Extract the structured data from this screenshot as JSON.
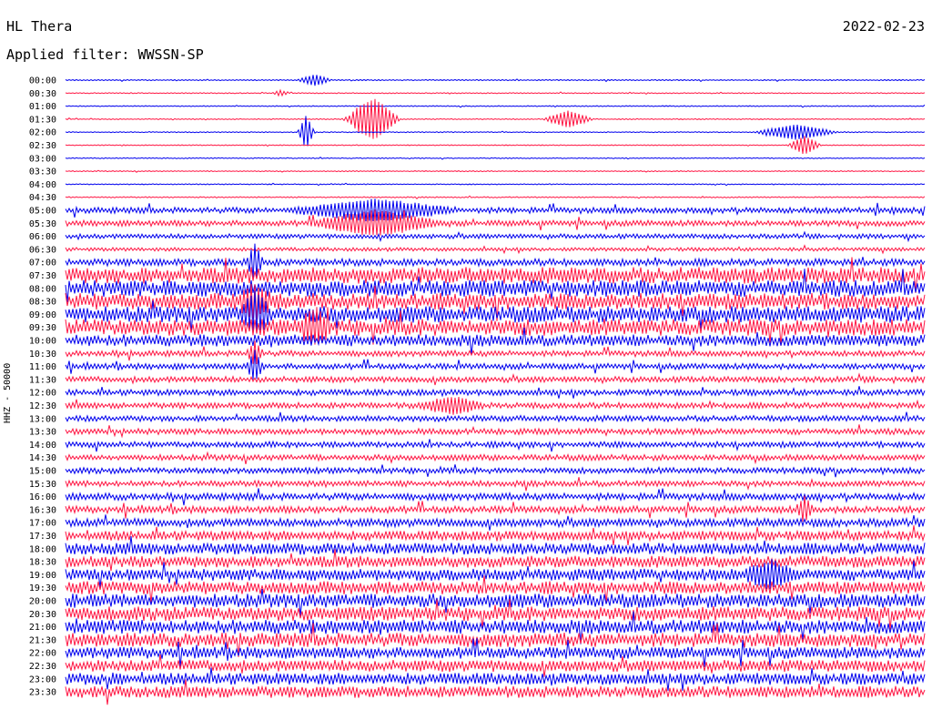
{
  "header": {
    "station": "HL Thera",
    "date": "2022-02-23",
    "filter_label": "Applied filter: WWSSN-SP",
    "channel_label": "HHZ - 50000"
  },
  "colors": {
    "even": "#0000ee",
    "odd": "#ff1744"
  },
  "chart_data": {
    "type": "line",
    "title": "HL Thera",
    "rows": [
      "00:00",
      "00:30",
      "01:00",
      "01:30",
      "02:00",
      "02:30",
      "03:00",
      "03:30",
      "04:00",
      "04:30",
      "05:00",
      "05:30",
      "06:00",
      "06:30",
      "07:00",
      "07:30",
      "08:00",
      "08:30",
      "09:00",
      "09:30",
      "10:00",
      "10:30",
      "11:00",
      "11:30",
      "12:00",
      "12:30",
      "13:00",
      "13:30",
      "14:00",
      "14:30",
      "15:00",
      "15:30",
      "16:00",
      "16:30",
      "17:00",
      "17:30",
      "18:00",
      "18:30",
      "19:00",
      "19:30",
      "20:00",
      "20:30",
      "21:00",
      "21:30",
      "22:00",
      "22:30",
      "23:00",
      "23:30"
    ],
    "noise_level": [
      0.5,
      0.4,
      0.4,
      0.4,
      0.4,
      0.4,
      0.4,
      0.4,
      0.4,
      0.5,
      2.5,
      2.5,
      2.0,
      1.5,
      3.0,
      7.0,
      7.0,
      7.0,
      7.0,
      7.0,
      5.0,
      2.5,
      2.5,
      2.5,
      2.5,
      2.5,
      2.5,
      2.5,
      2.5,
      2.5,
      2.5,
      2.5,
      3.0,
      3.0,
      3.5,
      4.0,
      5.0,
      5.0,
      5.0,
      5.5,
      6.0,
      6.0,
      6.0,
      6.0,
      5.0,
      5.0,
      5.0,
      5.0
    ],
    "events": [
      {
        "row": 0,
        "pos": 0.29,
        "amp": 6,
        "dur": 0.02
      },
      {
        "row": 1,
        "pos": 0.25,
        "amp": 3,
        "dur": 0.01
      },
      {
        "row": 3,
        "pos": 0.36,
        "amp": 22,
        "dur": 0.03
      },
      {
        "row": 3,
        "pos": 0.34,
        "amp": 6,
        "dur": 0.02
      },
      {
        "row": 3,
        "pos": 0.585,
        "amp": 9,
        "dur": 0.03
      },
      {
        "row": 4,
        "pos": 0.28,
        "amp": 18,
        "dur": 0.01
      },
      {
        "row": 4,
        "pos": 0.85,
        "amp": 8,
        "dur": 0.05
      },
      {
        "row": 5,
        "pos": 0.86,
        "amp": 10,
        "dur": 0.02
      },
      {
        "row": 10,
        "pos": 0.36,
        "amp": 10,
        "dur": 0.1
      },
      {
        "row": 11,
        "pos": 0.36,
        "amp": 12,
        "dur": 0.08
      },
      {
        "row": 14,
        "pos": 0.22,
        "amp": 20,
        "dur": 0.01
      },
      {
        "row": 17,
        "pos": 0.22,
        "amp": 16,
        "dur": 0.02
      },
      {
        "row": 18,
        "pos": 0.22,
        "amp": 18,
        "dur": 0.02
      },
      {
        "row": 19,
        "pos": 0.29,
        "amp": 16,
        "dur": 0.02
      },
      {
        "row": 21,
        "pos": 0.22,
        "amp": 12,
        "dur": 0.01
      },
      {
        "row": 22,
        "pos": 0.22,
        "amp": 16,
        "dur": 0.01
      },
      {
        "row": 25,
        "pos": 0.45,
        "amp": 8,
        "dur": 0.04
      },
      {
        "row": 38,
        "pos": 0.82,
        "amp": 12,
        "dur": 0.03
      },
      {
        "row": 33,
        "pos": 0.86,
        "amp": 12,
        "dur": 0.01
      }
    ]
  }
}
